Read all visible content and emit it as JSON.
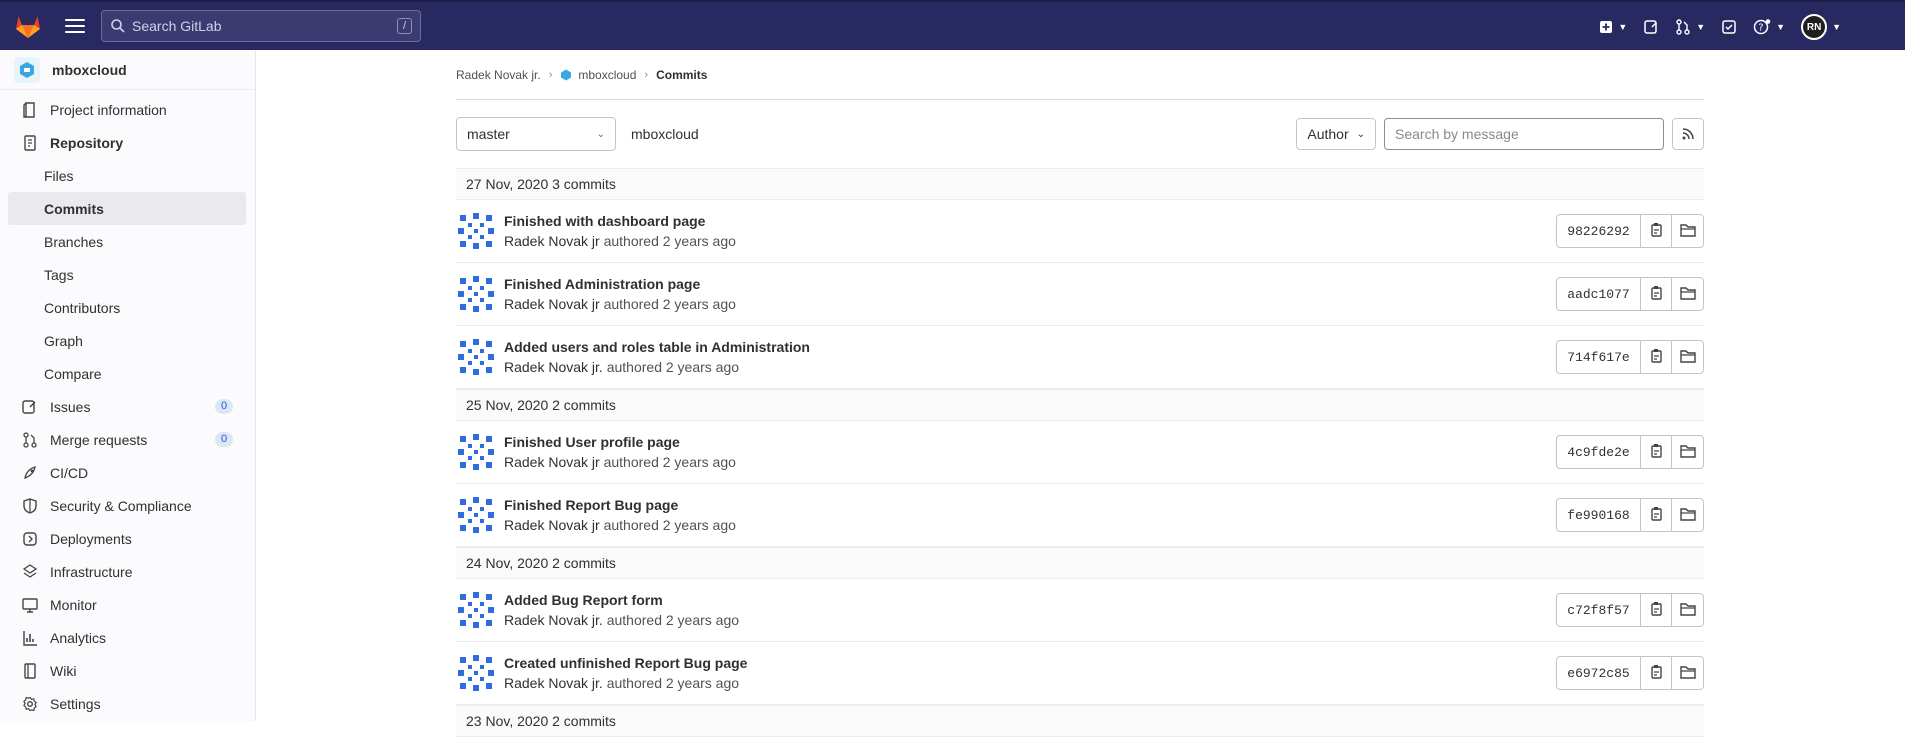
{
  "header": {
    "search_placeholder": "Search GitLab",
    "search_shortcut": "/",
    "user_initials": "RN"
  },
  "sidebar": {
    "project_name": "mboxcloud",
    "items": [
      {
        "label": "Project information",
        "icon": "project-information-icon"
      },
      {
        "label": "Repository",
        "icon": "repository-icon",
        "bold": true
      },
      {
        "label": "Issues",
        "icon": "issues-icon",
        "badge": "0"
      },
      {
        "label": "Merge requests",
        "icon": "merge-request-icon",
        "badge": "0"
      },
      {
        "label": "CI/CD",
        "icon": "rocket-icon"
      },
      {
        "label": "Security & Compliance",
        "icon": "shield-icon"
      },
      {
        "label": "Deployments",
        "icon": "deployments-icon"
      },
      {
        "label": "Infrastructure",
        "icon": "infrastructure-icon"
      },
      {
        "label": "Monitor",
        "icon": "monitor-icon"
      },
      {
        "label": "Analytics",
        "icon": "chart-icon"
      },
      {
        "label": "Wiki",
        "icon": "book-icon"
      },
      {
        "label": "Settings",
        "icon": "gear-icon"
      }
    ],
    "repository_sub": [
      "Files",
      "Commits",
      "Branches",
      "Tags",
      "Contributors",
      "Graph",
      "Compare"
    ],
    "active_sub": "Commits"
  },
  "breadcrumb": [
    "Radek Novak jr.",
    "mboxcloud",
    "Commits"
  ],
  "filters": {
    "branch": "master",
    "repo_path": "mboxcloud",
    "author_label": "Author",
    "search_placeholder": "Search by message"
  },
  "days": [
    {
      "label": "27 Nov, 2020 3 commits",
      "commits": [
        {
          "title": "Finished with dashboard page",
          "author": "Radek Novak jr",
          "ago": "authored 2 years ago",
          "sha": "98226292"
        },
        {
          "title": "Finished Administration page",
          "author": "Radek Novak jr",
          "ago": "authored 2 years ago",
          "sha": "aadc1077"
        },
        {
          "title": "Added users and roles table in Administration",
          "author": "Radek Novak jr.",
          "ago": "authored 2 years ago",
          "sha": "714f617e"
        }
      ]
    },
    {
      "label": "25 Nov, 2020 2 commits",
      "commits": [
        {
          "title": "Finished User profile page",
          "author": "Radek Novak jr",
          "ago": "authored 2 years ago",
          "sha": "4c9fde2e"
        },
        {
          "title": "Finished Report Bug page",
          "author": "Radek Novak jr",
          "ago": "authored 2 years ago",
          "sha": "fe990168"
        }
      ]
    },
    {
      "label": "24 Nov, 2020 2 commits",
      "commits": [
        {
          "title": "Added Bug Report form",
          "author": "Radek Novak jr.",
          "ago": "authored 2 years ago",
          "sha": "c72f8f57"
        },
        {
          "title": "Created unfinished Report Bug page",
          "author": "Radek Novak jr.",
          "ago": "authored 2 years ago",
          "sha": "e6972c85"
        }
      ]
    },
    {
      "label": "23 Nov, 2020 2 commits",
      "commits": []
    }
  ]
}
